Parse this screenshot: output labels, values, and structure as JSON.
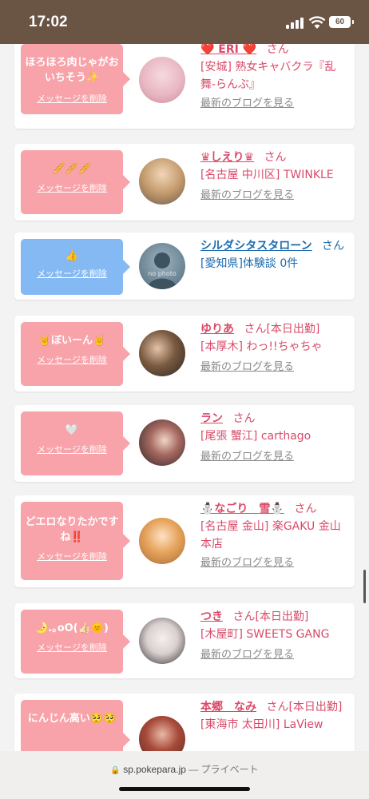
{
  "status": {
    "time": "17:02",
    "battery": "60"
  },
  "cards": [
    {
      "bubble": "ほろほろ肉じゃがおいちそう✨",
      "delete": "メッセージを削除",
      "name": "❤️ ERI ❤️",
      "san": "さん",
      "shop": "[安城] 熟女キャバクラ『乱舞-らんぶ』",
      "blog": "最新のブログを見る"
    },
    {
      "bubble": "🥖🥖🥖",
      "delete": "メッセージを削除",
      "name": "♛しえり♛",
      "san": "さん",
      "shop": "[名古屋 中川区] TWINKLE",
      "blog": "最新のブログを見る"
    },
    {
      "bubble": "👍",
      "delete": "メッセージを削除",
      "name": "シルダシタスタローン",
      "san": "さん",
      "shop": "[愛知県]体験談 0件",
      "avatar_text": "no photo"
    },
    {
      "bubble": "🤘ぼいーん🤘",
      "delete": "メッセージを削除",
      "name": "ゆりあ",
      "san": "さん[本日出勤]",
      "shop": "[本厚木] わっ!!ちゃちゃ",
      "blog": "最新のブログを見る"
    },
    {
      "bubble": "🤍",
      "delete": "メッセージを削除",
      "name": "ラン",
      "san": "さん",
      "shop": "[尾張 蟹江] carthago",
      "blog": "最新のブログを見る"
    },
    {
      "bubble": "どエロなりたかですね‼️",
      "delete": "メッセージを削除",
      "name": "⛄なごり　雪⛄",
      "san": "さん",
      "shop": "[名古屋 金山] 楽GAKU 金山本店",
      "blog": "最新のブログを見る"
    },
    {
      "bubble": "🌛.｡oO(👍🏻🌞)",
      "delete": "メッセージを削除",
      "name": "つき",
      "san": "さん[本日出勤]",
      "shop": "[木屋町] SWEETS GANG",
      "blog": "最新のブログを見る"
    },
    {
      "bubble": "にんじん高い🥺🥺",
      "name": "本郷　なみ",
      "san": "さん[本日出勤]",
      "shop": "[東海市 太田川] LaView"
    }
  ],
  "browser": {
    "domain": "sp.pokepara.jp",
    "mode": "— プライベート"
  }
}
